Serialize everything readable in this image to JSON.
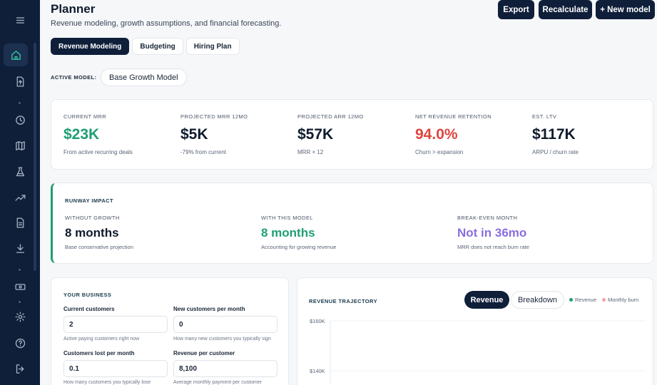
{
  "sidebar": {
    "icons": [
      "menu-icon",
      "home-icon",
      "upload-file-icon",
      "clock-icon",
      "map-icon",
      "flask-icon",
      "trending-up-icon",
      "document-icon",
      "download-icon",
      "money-icon",
      "settings-icon",
      "help-icon",
      "logout-icon"
    ]
  },
  "header": {
    "title": "Planner",
    "subtitle": "Revenue modeling, growth assumptions, and financial forecasting.",
    "export_label": "Export",
    "recalculate_label": "Recalculate",
    "new_model_label": "+ New model"
  },
  "tabs": [
    {
      "label": "Revenue Modeling",
      "active": true
    },
    {
      "label": "Budgeting",
      "active": false
    },
    {
      "label": "Hiring Plan",
      "active": false
    }
  ],
  "active_model": {
    "label": "ACTIVE MODEL:",
    "value": "Base Growth Model"
  },
  "kpis": [
    {
      "label": "CURRENT MRR",
      "value": "$23K",
      "sub": "From active recurring deals",
      "color": "#1f9e75"
    },
    {
      "label": "PROJECTED MRR 12MO",
      "value": "$5K",
      "sub": "-79% from current",
      "color": "#0f1b2d"
    },
    {
      "label": "PROJECTED ARR 12MO",
      "value": "$57K",
      "sub": "MRR × 12",
      "color": "#0f1b2d"
    },
    {
      "label": "NET REVENUE RETENTION",
      "value": "94.0%",
      "sub": "Churn > expansion",
      "color": "#e0453e"
    },
    {
      "label": "EST. LTV",
      "value": "$117K",
      "sub": "ARPU / churn rate",
      "color": "#0f1b2d"
    }
  ],
  "runway": {
    "title": "RUNWAY IMPACT",
    "items": [
      {
        "label": "WITHOUT GROWTH",
        "value": "8 months",
        "sub": "Base conservative projection",
        "color": "#0f1b2d"
      },
      {
        "label": "WITH THIS MODEL",
        "value": "8 months",
        "sub": "Accounting for growing revenue",
        "color": "#1f9e75"
      },
      {
        "label": "BREAK-EVEN MONTH",
        "value": "Not in 36mo",
        "sub": "MRR does not reach burn rate",
        "color": "#8a6ee0"
      }
    ]
  },
  "business": {
    "title": "YOUR BUSINESS",
    "fields": [
      {
        "label": "Current customers",
        "value": "2",
        "help": "Active paying customers right now"
      },
      {
        "label": "New customers per month",
        "value": "0",
        "help": "How many new customers you typically sign"
      },
      {
        "label": "Customers lost per month",
        "value": "0.1",
        "help": "How many customers you typically lose"
      },
      {
        "label": "Revenue per customer",
        "value": "8,100",
        "help": "Average monthly payment per customer"
      }
    ]
  },
  "trajectory": {
    "title": "REVENUE TRAJECTORY",
    "toggle_revenue": "Revenue",
    "toggle_breakdown": "Breakdown",
    "legend_revenue": "Revenue",
    "legend_burn": "Monthly burn",
    "revenue_color": "#1f9e75",
    "burn_color": "#f2a3a3"
  },
  "chart_data": {
    "type": "line",
    "title": "REVENUE TRAJECTORY",
    "y_tick_labels": [
      "$160K",
      "$140K"
    ],
    "y_ticks": [
      160000,
      140000
    ],
    "series": [
      {
        "name": "Revenue",
        "values": []
      },
      {
        "name": "Monthly burn",
        "values": []
      }
    ],
    "grid": true,
    "legend": "top-right"
  }
}
